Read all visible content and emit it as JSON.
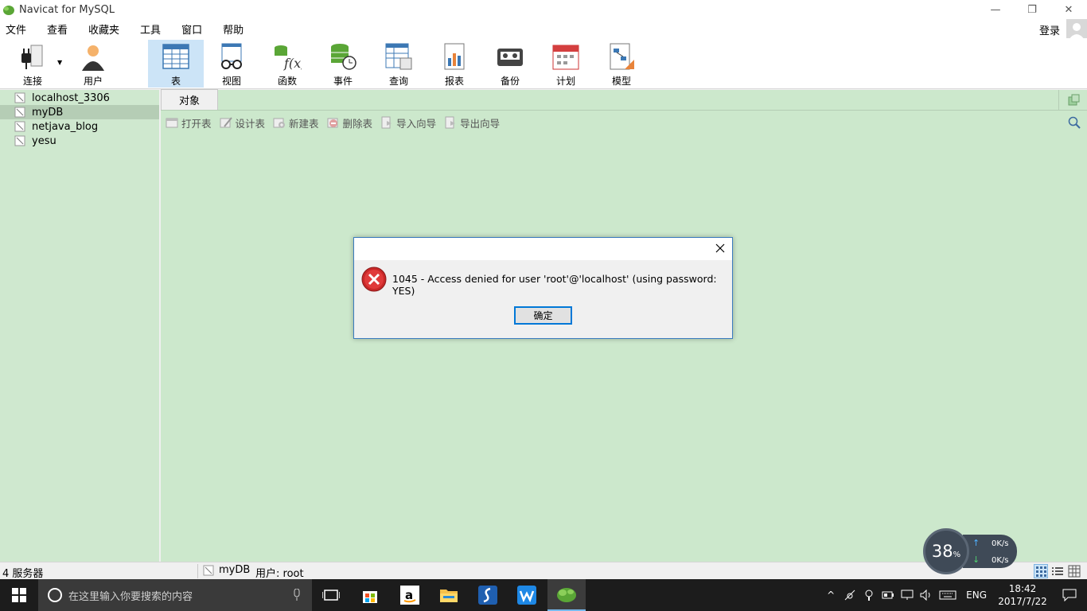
{
  "window": {
    "title": "Navicat for MySQL",
    "minimize": "—",
    "restore": "❐",
    "close": "✕"
  },
  "menu": [
    "文件",
    "查看",
    "收藏夹",
    "工具",
    "窗口",
    "帮助"
  ],
  "login_label": "登录",
  "toolbar": {
    "connect": "连接",
    "user": "用户",
    "table": "表",
    "view": "视图",
    "function": "函数",
    "event": "事件",
    "query": "查询",
    "report": "报表",
    "backup": "备份",
    "schedule": "计划",
    "model": "模型"
  },
  "connections": [
    "localhost_3306",
    "myDB",
    "netjava_blog",
    "yesu"
  ],
  "tabs": [
    "对象"
  ],
  "object_actions": [
    "打开表",
    "设计表",
    "新建表",
    "删除表",
    "导入向导",
    "导出向导"
  ],
  "status": {
    "servers": "4 服务器",
    "database": "myDB",
    "user": "用户: root"
  },
  "dialog": {
    "message": "1045 - Access denied for user 'root'@'localhost' (using password: YES)",
    "ok": "确定",
    "close": "✕"
  },
  "network": {
    "percent": "38",
    "percent_sign": "%",
    "upload": "0K/s",
    "download": "0K/s"
  },
  "taskbar": {
    "search_placeholder": "在这里输入你要搜索的内容",
    "language": "ENG",
    "time": "18:42",
    "date": "2017/7/22"
  },
  "colors": {
    "main_bg": "#cce8cc",
    "sidebar_bg": "#cfe8cf",
    "selected_bg": "#b5cdb5",
    "accent": "#0078d7",
    "error_red": "#d42a2a"
  }
}
